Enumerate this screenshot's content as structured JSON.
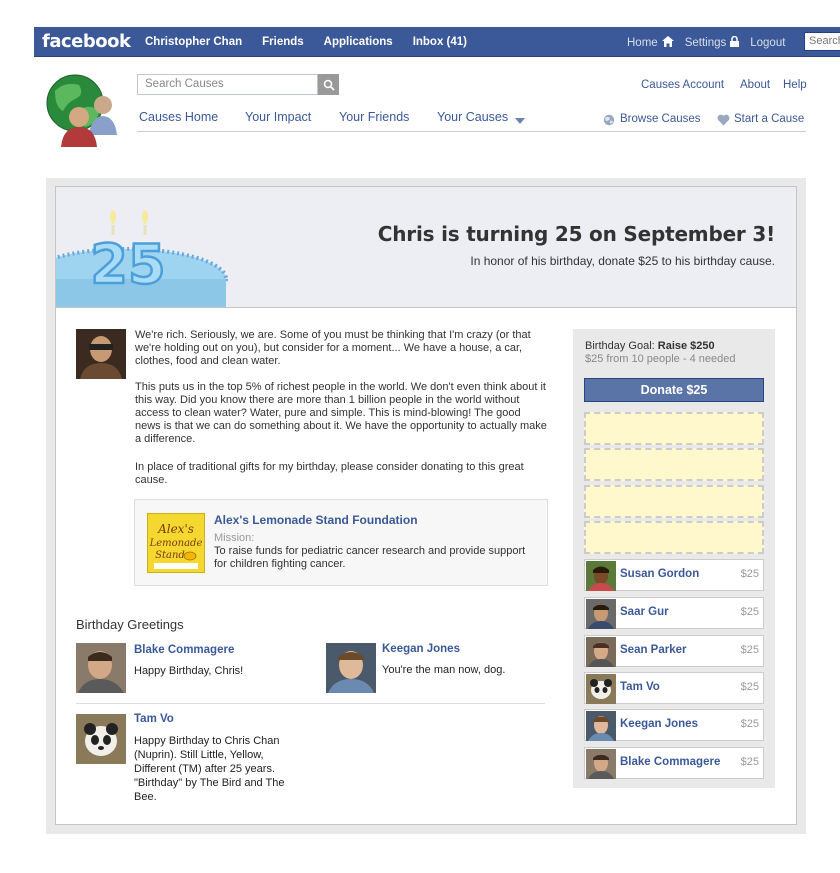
{
  "topbar": {
    "logo": "facebook",
    "nav": [
      "Christopher Chan",
      "Friends",
      "Applications",
      "Inbox (41)"
    ],
    "home": "Home",
    "settings": "Settings",
    "logout": "Logout",
    "search_placeholder": "Search"
  },
  "causes": {
    "search_placeholder": "Search Causes",
    "nav": [
      "Causes Home",
      "Your Impact",
      "Your Friends",
      "Your Causes"
    ],
    "account": "Causes Account",
    "about": "About",
    "help": "Help",
    "browse": "Browse Causes",
    "start": "Start a Cause"
  },
  "banner": {
    "cake_number": "25",
    "headline": "Chris is turning 25 on September 3!",
    "subline": "In honor of his birthday, donate $25 to his birthday cause."
  },
  "message": {
    "p1": "We're rich. Seriously, we are. Some of you must be thinking that I'm crazy (or that we're holding out on you), but consider for a moment... We have a house, a car, clothes, food and clean water.",
    "p2": "This puts us in the top 5% of richest people in the world. We don't even think about it this way. Did you know there are more than 1 billion people in the world without access to clean water? Water, pure and simple. This is mind-blowing! The good news is that we can do something about it. We have the opportunity to actually make a difference.",
    "p3": "In place of traditional gifts for my birthday, please consider donating to this great cause."
  },
  "org": {
    "logo_text": "Alex's Lemonade Stand",
    "name": "Alex's Lemonade Stand Foundation",
    "mission_label": "Mission:",
    "mission": "To raise funds for pediatric cancer research and provide support for children fighting cancer."
  },
  "greetings": {
    "title": "Birthday Greetings",
    "items": [
      {
        "name": "Blake Commagere",
        "msg": "Happy Birthday, Chris!"
      },
      {
        "name": "Keegan Jones",
        "msg": "You're the man now, dog."
      },
      {
        "name": "Tam Vo",
        "msg": "Happy Birthday to Chris Chan (Nuprin). Still Little, Yellow, Different (TM) after 25 years. \"Birthday\" by The Bird and The Bee."
      }
    ]
  },
  "goal": {
    "label": "Birthday Goal:",
    "amount": "Raise $250",
    "progress": "$25 from 10 people - 4 needed",
    "donate_label": "Donate $25"
  },
  "donors": [
    {
      "name": "Susan Gordon",
      "amount": "$25"
    },
    {
      "name": "Saar Gur",
      "amount": "$25"
    },
    {
      "name": "Sean Parker",
      "amount": "$25"
    },
    {
      "name": "Tam Vo",
      "amount": "$25"
    },
    {
      "name": "Keegan Jones",
      "amount": "$25"
    },
    {
      "name": "Blake Commagere",
      "amount": "$25"
    }
  ],
  "colors": {
    "brand": "#3b5998",
    "slot": "#fff8cc"
  }
}
